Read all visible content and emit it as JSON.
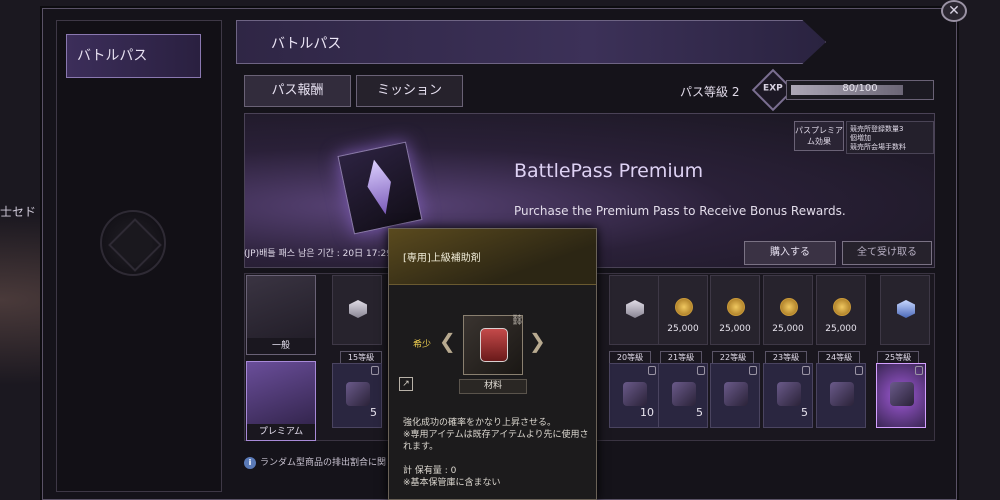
{
  "left_edge_text": "士セド",
  "sidebar": {
    "items": [
      {
        "label": "バトルパス"
      }
    ]
  },
  "header": {
    "title": "バトルパス"
  },
  "tabs": [
    {
      "label": "パス報酬"
    },
    {
      "label": "ミッション"
    }
  ],
  "pass_level": {
    "label": "パス等級 2",
    "exp_icon": "EXP",
    "exp_text": "80/100",
    "exp_progress": 0.8
  },
  "banner": {
    "title": "BattlePass Premium",
    "subtitle": "Purchase the Premium Pass to Receive Bonus Rewards.",
    "premium_effect_label": "パスプレミアム効果",
    "premium_effects": [
      "競売所登録数量3",
      "個増加",
      "競売所会場手数料"
    ],
    "remaining": "(JP)배틀 패스 남은 기간 : 20日 17:29:",
    "buy_button": "購入する",
    "claim_all_button": "全て受け取る"
  },
  "tiers": {
    "general_label": "一般",
    "premium_label": "プレミアム"
  },
  "general_rewards": [
    {
      "icon": "box-icon",
      "value": ""
    },
    {
      "icon": "box-icon",
      "value": ""
    },
    {
      "icon": "coin-icon",
      "value": "25,000"
    },
    {
      "icon": "coin-icon",
      "value": "25,000"
    },
    {
      "icon": "coin-icon",
      "value": "25,000"
    },
    {
      "icon": "coin-icon",
      "value": "25,000"
    },
    {
      "icon": "blue-box-icon",
      "value": ""
    }
  ],
  "levels": [
    "15等級",
    "20等級",
    "21等級",
    "22等級",
    "23等級",
    "24等級",
    "25等級"
  ],
  "premium_rewards": [
    {
      "icon": "pouch-icon",
      "count": "5"
    },
    {
      "icon": "red-jar-icon",
      "count": "10"
    },
    {
      "icon": "crystal-icon",
      "count": "5"
    },
    {
      "icon": "ore-icon",
      "count": ""
    },
    {
      "icon": "horn-icon",
      "count": "5"
    },
    {
      "icon": "scroll-icon",
      "count": ""
    },
    {
      "icon": "purple-orb-icon",
      "count": ""
    }
  ],
  "notice": "ランダム型商品の排出割合に関し",
  "tooltip": {
    "title": "[専用]上級補助剤",
    "rarity": "希少",
    "type": "材料",
    "desc_line1": "強化成功の確率をかなり上昇させる。",
    "desc_line2": "※専用アイテムは既存アイテムより先に使用されます。",
    "qty_line1": "計 保有量 : 0",
    "qty_line2": "※基本保管庫に含まない"
  },
  "colors": {
    "accent": "#8a78b0",
    "coin": "#f0c860",
    "rarity": "#f0d050"
  }
}
